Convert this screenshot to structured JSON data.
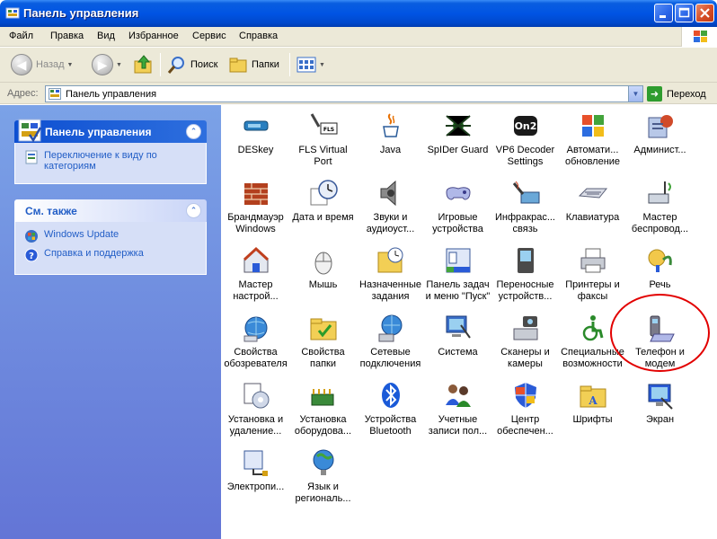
{
  "window": {
    "title": "Панель управления",
    "icon": "control-panel-icon"
  },
  "menu": {
    "items": [
      "Файл",
      "Правка",
      "Вид",
      "Избранное",
      "Сервис",
      "Справка"
    ]
  },
  "toolbar": {
    "back_label": "Назад",
    "search_label": "Поиск",
    "folders_label": "Папки"
  },
  "address": {
    "label": "Адрес:",
    "value": "Панель управления",
    "go_label": "Переход"
  },
  "tasks": {
    "title": "Панель управления",
    "switch_view": "Переключение к виду по категориям"
  },
  "see_also": {
    "title": "См. также",
    "links": [
      "Windows Update",
      "Справка и поддержка"
    ]
  },
  "items": [
    {
      "label": "DESkey",
      "icon": "usb-key-icon"
    },
    {
      "label": "FLS Virtual Port",
      "icon": "serial-port-icon"
    },
    {
      "label": "Java",
      "icon": "java-cup-icon"
    },
    {
      "label": "SpIDer Guard",
      "icon": "spider-icon"
    },
    {
      "label": "VP6 Decoder Settings",
      "icon": "on2-decoder-icon"
    },
    {
      "label": "Автомати... обновление",
      "icon": "windows-shield-icon"
    },
    {
      "label": "Админист...",
      "icon": "admin-tools-icon"
    },
    {
      "label": "Брандмауэр Windows",
      "icon": "firewall-icon"
    },
    {
      "label": "Дата и время",
      "icon": "clock-icon"
    },
    {
      "label": "Звуки и аудиоуст...",
      "icon": "speaker-icon"
    },
    {
      "label": "Игровые устройства",
      "icon": "gamepad-icon"
    },
    {
      "label": "Инфракрас... связь",
      "icon": "infrared-icon"
    },
    {
      "label": "Клавиатура",
      "icon": "keyboard-icon"
    },
    {
      "label": "Мастер беспровод...",
      "icon": "wireless-icon"
    },
    {
      "label": "Мастер настрой...",
      "icon": "network-setup-icon"
    },
    {
      "label": "Мышь",
      "icon": "mouse-icon"
    },
    {
      "label": "Назначенные задания",
      "icon": "scheduled-tasks-icon"
    },
    {
      "label": "Панель задач и меню \"Пуск\"",
      "icon": "taskbar-icon"
    },
    {
      "label": "Переносные устройств...",
      "icon": "portable-device-icon"
    },
    {
      "label": "Принтеры и факсы",
      "icon": "printer-icon"
    },
    {
      "label": "Речь",
      "icon": "speech-icon"
    },
    {
      "label": "Свойства обозревателя",
      "icon": "internet-options-icon"
    },
    {
      "label": "Свойства папки",
      "icon": "folder-options-icon"
    },
    {
      "label": "Сетевые подключения",
      "icon": "network-connections-icon"
    },
    {
      "label": "Система",
      "icon": "system-icon"
    },
    {
      "label": "Сканеры и камеры",
      "icon": "scanner-camera-icon"
    },
    {
      "label": "Специальные возможности",
      "icon": "accessibility-icon"
    },
    {
      "label": "Телефон и модем",
      "icon": "phone-modem-icon"
    },
    {
      "label": "Установка и удаление...",
      "icon": "add-remove-programs-icon"
    },
    {
      "label": "Установка оборудова...",
      "icon": "add-hardware-icon"
    },
    {
      "label": "Устройства Bluetooth",
      "icon": "bluetooth-icon"
    },
    {
      "label": "Учетные записи пол...",
      "icon": "user-accounts-icon"
    },
    {
      "label": "Центр обеспечен...",
      "icon": "security-center-icon"
    },
    {
      "label": "Шрифты",
      "icon": "fonts-folder-icon"
    },
    {
      "label": "Экран",
      "icon": "display-icon"
    },
    {
      "label": "Электропи...",
      "icon": "power-options-icon"
    },
    {
      "label": "Язык и региональ...",
      "icon": "regional-options-icon"
    }
  ],
  "highlight": {
    "target": "Телефон и модем",
    "color": "#e20000"
  },
  "colors": {
    "titlebar": "#0054e3",
    "taskpane": "#6375d6",
    "link": "#215dc6"
  }
}
